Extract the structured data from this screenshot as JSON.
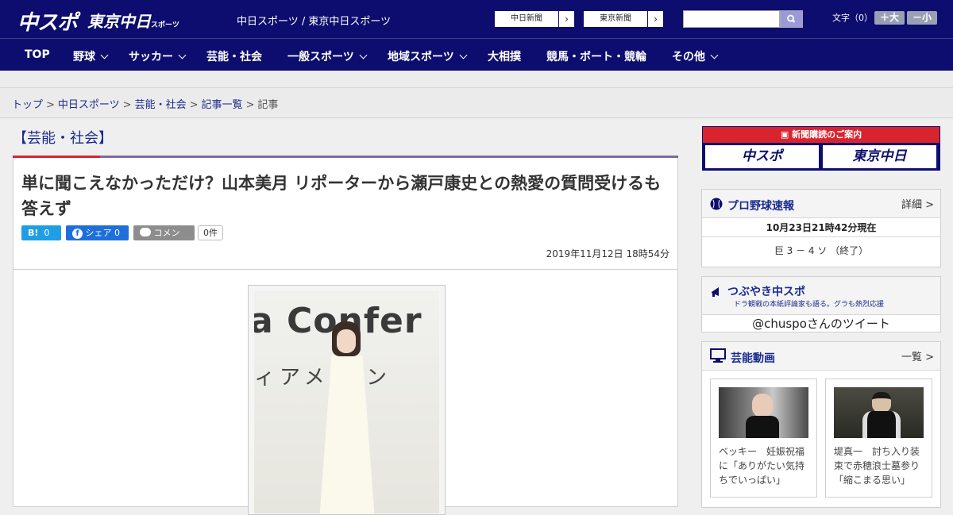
{
  "header": {
    "logo_main": "中スポ",
    "logo_tokyo": "東京中日",
    "logo_tokyo_suffix": "スポーツ",
    "site_name": "中日スポーツ / 東京中日スポーツ",
    "chunichi_link": "中日新聞",
    "tokyo_link": "東京新聞",
    "font_size_label": "文字（0）",
    "font_plus": "＋大",
    "font_minus": "－小"
  },
  "nav": [
    {
      "label": "TOP"
    },
    {
      "label": "野球"
    },
    {
      "label": "サッカー"
    },
    {
      "label": "芸能・社会"
    },
    {
      "label": "一般スポーツ"
    },
    {
      "label": "地域スポーツ"
    },
    {
      "label": "大相撲"
    },
    {
      "label": "競馬・ボート・競輪"
    },
    {
      "label": "その他"
    }
  ],
  "breadcrumb": [
    "トップ",
    "中日スポーツ",
    "芸能・社会",
    "記事一覧",
    "記事"
  ],
  "article": {
    "category": "【芸能・社会】",
    "headline": "単に聞こえなかっただけ？山本美月 リポーターから瀬戸康史との熱愛の質問受けるも答えず",
    "share_hatena": "0",
    "share_facebook": "シェア 0",
    "share_comment": "コメント",
    "comment_count": "0件",
    "date": "2019年11月12日 18時54分",
    "photo_text_1": "a Confer",
    "photo_text_2": "ィアメ  レン"
  },
  "sidebar": {
    "subscribe_banner": "新聞購読のご案内",
    "subscribe_chunichi": "中スポ",
    "subscribe_tokyo": "東京中日",
    "baseball": {
      "title": "プロ野球速報",
      "more": "詳細 >",
      "time": "10月23日21時42分現在",
      "score": "巨 3 － 4 ソ （終了）"
    },
    "tweet": {
      "title": "つぶやき中スポ",
      "subtitle": "ドラ観戦の本紙評論家も語る。グラも熱烈応援",
      "link": "@chuspoさんのツイート"
    },
    "video": {
      "title": "芸能動画",
      "more": "一覧 >",
      "items": [
        {
          "caption": "ベッキー　妊娠祝福に「ありがたい気持ちでいっぱい」"
        },
        {
          "caption": "堤真一　討ち入り装束で赤穂浪士墓参り「縮こまる思い」"
        }
      ]
    }
  },
  "colors": {
    "brand_navy": "#0c0d6e",
    "accent_red": "#d8242e",
    "link_blue": "#1a2a8e"
  }
}
